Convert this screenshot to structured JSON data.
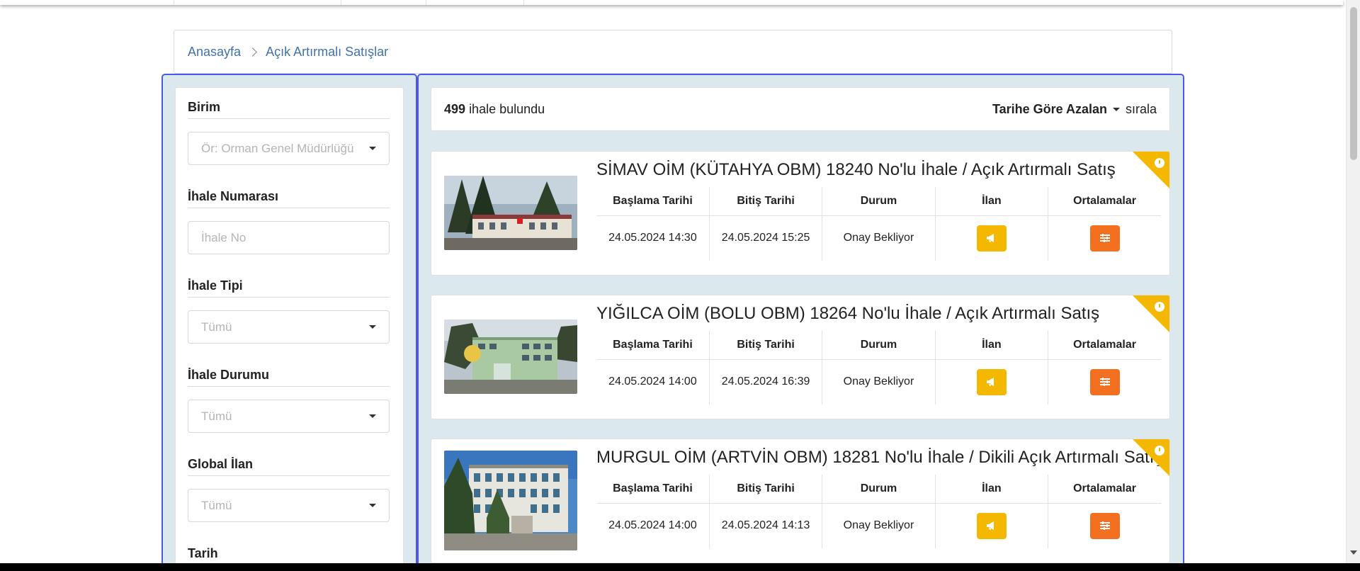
{
  "breadcrumb": {
    "home": "Anasayfa",
    "current": "Açık Artırmalı Satışlar"
  },
  "filters": [
    {
      "label": "Birim",
      "placeholder": "Ör: Orman Genel Müdürlüğü",
      "type": "select"
    },
    {
      "label": "İhale Numarası",
      "placeholder": "İhale No",
      "type": "input"
    },
    {
      "label": "İhale Tipi",
      "placeholder": "Tümü",
      "type": "select"
    },
    {
      "label": "İhale Durumu",
      "placeholder": "Tümü",
      "type": "select"
    },
    {
      "label": "Global İlan",
      "placeholder": "Tümü",
      "type": "select"
    },
    {
      "label": "Tarih"
    }
  ],
  "results": {
    "count": "499",
    "count_suffix": "ihale bulundu",
    "sort_label": "Tarihe Göre Azalan",
    "sort_suffix": "sırala"
  },
  "table_headers": {
    "start": "Başlama Tarihi",
    "end": "Bitiş Tarihi",
    "status": "Durum",
    "notice": "İlan",
    "averages": "Ortalamalar"
  },
  "icons": {
    "notice": "megaphone-icon",
    "averages": "sliders-icon",
    "corner": "clock-icon",
    "dropdown": "caret-down-icon",
    "breadcrumb_sep": "chevron-right-icon"
  },
  "colors": {
    "accent_yellow": "#f5b800",
    "accent_orange": "#f37021",
    "link_blue": "#3f72af",
    "panel_bg": "#dbe8ee",
    "panel_border": "#4a5ae8"
  },
  "auctions": [
    {
      "title": "SİMAV OİM (KÜTAHYA OBM) 18240 No'lu İhale / Açık Artırmalı Satış",
      "start": "24.05.2024 14:30",
      "end": "24.05.2024 15:25",
      "status": "Onay Bekliyor"
    },
    {
      "title": "YIĞILCA OİM (BOLU OBM) 18264 No'lu İhale / Açık Artırmalı Satış",
      "start": "24.05.2024 14:00",
      "end": "24.05.2024 16:39",
      "status": "Onay Bekliyor"
    },
    {
      "title": "MURGUL OİM (ARTVİN OBM) 18281 No'lu İhale / Dikili Açık Artırmalı Satış",
      "start": "24.05.2024 14:00",
      "end": "24.05.2024 14:13",
      "status": "Onay Bekliyor"
    }
  ]
}
